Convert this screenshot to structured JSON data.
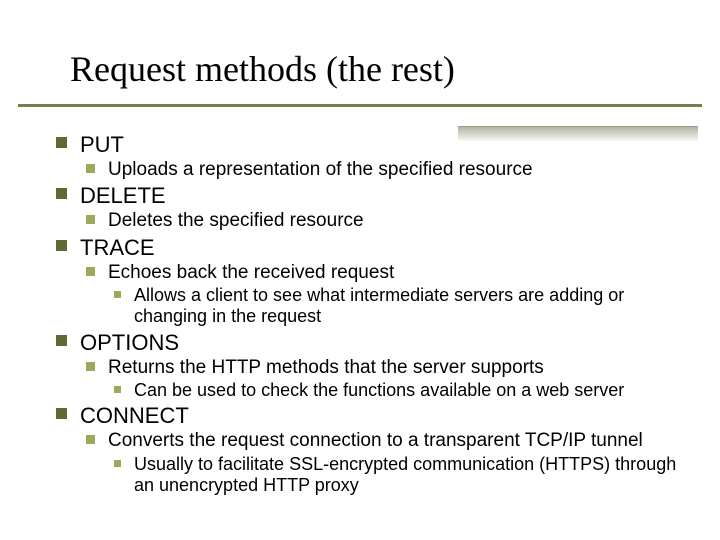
{
  "title": "Request methods (the rest)",
  "items": [
    {
      "label": "PUT",
      "sub": [
        {
          "text": "Uploads a representation of the specified resource"
        }
      ]
    },
    {
      "label": "DELETE",
      "sub": [
        {
          "text": "Deletes the specified resource"
        }
      ]
    },
    {
      "label": "TRACE",
      "sub": [
        {
          "text": "Echoes back the received request",
          "sub": [
            {
              "text": "Allows a client to see what intermediate servers are adding or changing in the request"
            }
          ]
        }
      ]
    },
    {
      "label": "OPTIONS",
      "sub": [
        {
          "text": "Returns the HTTP methods that the server supports",
          "sub": [
            {
              "text": "Can be used to check the functions available on a web server"
            }
          ]
        }
      ]
    },
    {
      "label": "CONNECT",
      "sub": [
        {
          "text": "Converts the request connection to a transparent TCP/IP tunnel",
          "sub": [
            {
              "text": "Usually to facilitate SSL-encrypted communication (HTTPS) through an unencrypted HTTP proxy"
            }
          ]
        }
      ]
    }
  ]
}
